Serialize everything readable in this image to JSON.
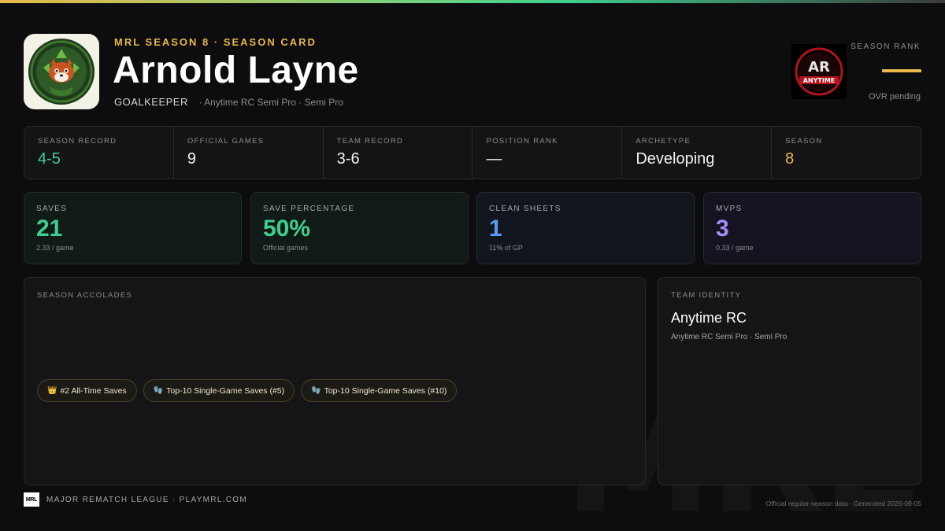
{
  "header": {
    "eyebrow": "MRL SEASON 8 · SEASON CARD",
    "player_name": "Arnold Layne",
    "position": "GOALKEEPER",
    "team_line": "· Anytime RC Semi Pro · Semi Pro",
    "avatar_icon": "red-panda-emblem-icon",
    "team_logo_icon": "anytime-rc-logo-icon",
    "team_logo_text": "ANYTIME",
    "team_logo_mark": "AR"
  },
  "rank": {
    "label": "SEASON RANK",
    "ovr_status": "OVR pending"
  },
  "strip": [
    {
      "label": "SEASON RECORD",
      "value": "4-5",
      "color": "#3ecf8e"
    },
    {
      "label": "OFFICIAL GAMES",
      "value": "9",
      "color": "#f2f2f2"
    },
    {
      "label": "TEAM RECORD",
      "value": "3-6",
      "color": "#f2f2f2"
    },
    {
      "label": "POSITION RANK",
      "value": "—",
      "color": "#f2f2f2"
    },
    {
      "label": "ARCHETYPE",
      "value": "Developing",
      "color": "#f2f2f2"
    },
    {
      "label": "SEASON",
      "value": "8",
      "color": "#e8b84a"
    }
  ],
  "cards": [
    {
      "label": "SAVES",
      "value": "21",
      "sub": "2.33 / game",
      "color": "#3ecf8e"
    },
    {
      "label": "SAVE PERCENTAGE",
      "value": "50%",
      "sub": "Official games",
      "color": "#3ecf8e"
    },
    {
      "label": "CLEAN SHEETS",
      "value": "1",
      "sub": "11% of GP",
      "color": "#5b9cf0"
    },
    {
      "label": "MVPS",
      "value": "3",
      "sub": "0.33 / game",
      "color": "#a78bfa"
    }
  ],
  "accolades": {
    "label": "SEASON ACCOLADES",
    "items": [
      {
        "icon": "crown-icon",
        "glyph": "👑",
        "text": "#2 All-Time Saves"
      },
      {
        "icon": "glove-icon",
        "glyph": "🧤",
        "text": "Top-10 Single-Game Saves (#5)"
      },
      {
        "icon": "glove-icon",
        "glyph": "🧤",
        "text": "Top-10 Single-Game Saves (#10)"
      }
    ]
  },
  "team_identity": {
    "label": "TEAM IDENTITY",
    "name": "Anytime RC",
    "sub": "Anytime RC Semi Pro · Semi Pro"
  },
  "footer": {
    "logo_text": "MRL",
    "league": "MAJOR REMATCH LEAGUE · PLAYMRL.COM",
    "generated": "Official regular-season data · Generated 2026-09-05",
    "watermark": "MRL"
  }
}
